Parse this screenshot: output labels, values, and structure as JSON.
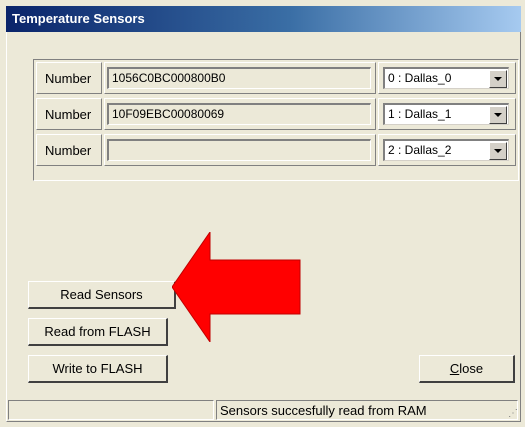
{
  "window": {
    "title": "Temperature Sensors"
  },
  "sensors": [
    {
      "label": "Number",
      "value": "1056C0BC000800B0",
      "selection": "0 : Dallas_0"
    },
    {
      "label": "Number",
      "value": "10F09EBC00080069",
      "selection": "1 : Dallas_1"
    },
    {
      "label": "Number",
      "value": "",
      "selection": "2 : Dallas_2"
    }
  ],
  "buttons": {
    "read_sensors": "Read Sensors",
    "read_flash": "Read from FLASH",
    "write_flash": "Write to FLASH",
    "close": "Close"
  },
  "status": {
    "left": "",
    "message": "Sensors succesfully read from RAM"
  },
  "colors": {
    "arrow": "#ff0000",
    "title_start": "#0a246a",
    "title_end": "#a6caf0"
  },
  "icons": {
    "combo_arrow": "chevron-down-icon",
    "annotation": "arrow-left-icon"
  }
}
